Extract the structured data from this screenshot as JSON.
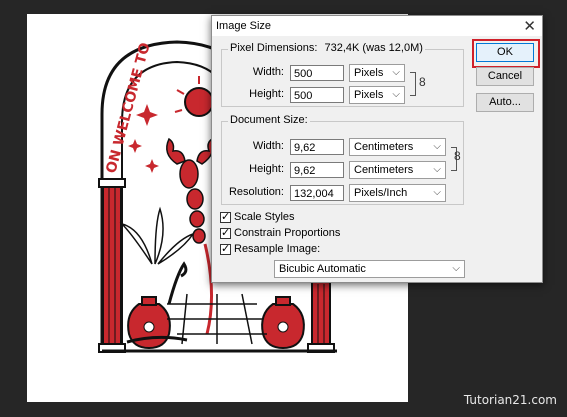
{
  "dialog": {
    "title": "Image Size",
    "pixel_dimensions": {
      "label": "Pixel Dimensions:",
      "value": "732,4K (was 12,0M)",
      "width_label": "Width:",
      "width_value": "500",
      "width_unit": "Pixels",
      "height_label": "Height:",
      "height_value": "500",
      "height_unit": "Pixels"
    },
    "document_size": {
      "label": "Document Size:",
      "width_label": "Width:",
      "width_value": "9,62",
      "width_unit": "Centimeters",
      "height_label": "Height:",
      "height_value": "9,62",
      "height_unit": "Centimeters",
      "resolution_label": "Resolution:",
      "resolution_value": "132,004",
      "resolution_unit": "Pixels/Inch"
    },
    "options": {
      "scale_styles": "Scale Styles",
      "constrain_proportions": "Constrain Proportions",
      "resample_image": "Resample Image:",
      "resample_method": "Bicubic Automatic"
    },
    "buttons": {
      "ok": "OK",
      "cancel": "Cancel",
      "auto": "Auto..."
    }
  },
  "artwork": {
    "arch_text": "ON WELCOME TO"
  },
  "watermark": "Tutorian21.com",
  "colors": {
    "highlight": "#d0202a",
    "artwork_red": "#c8282e",
    "canvas_bg": "#262626"
  }
}
